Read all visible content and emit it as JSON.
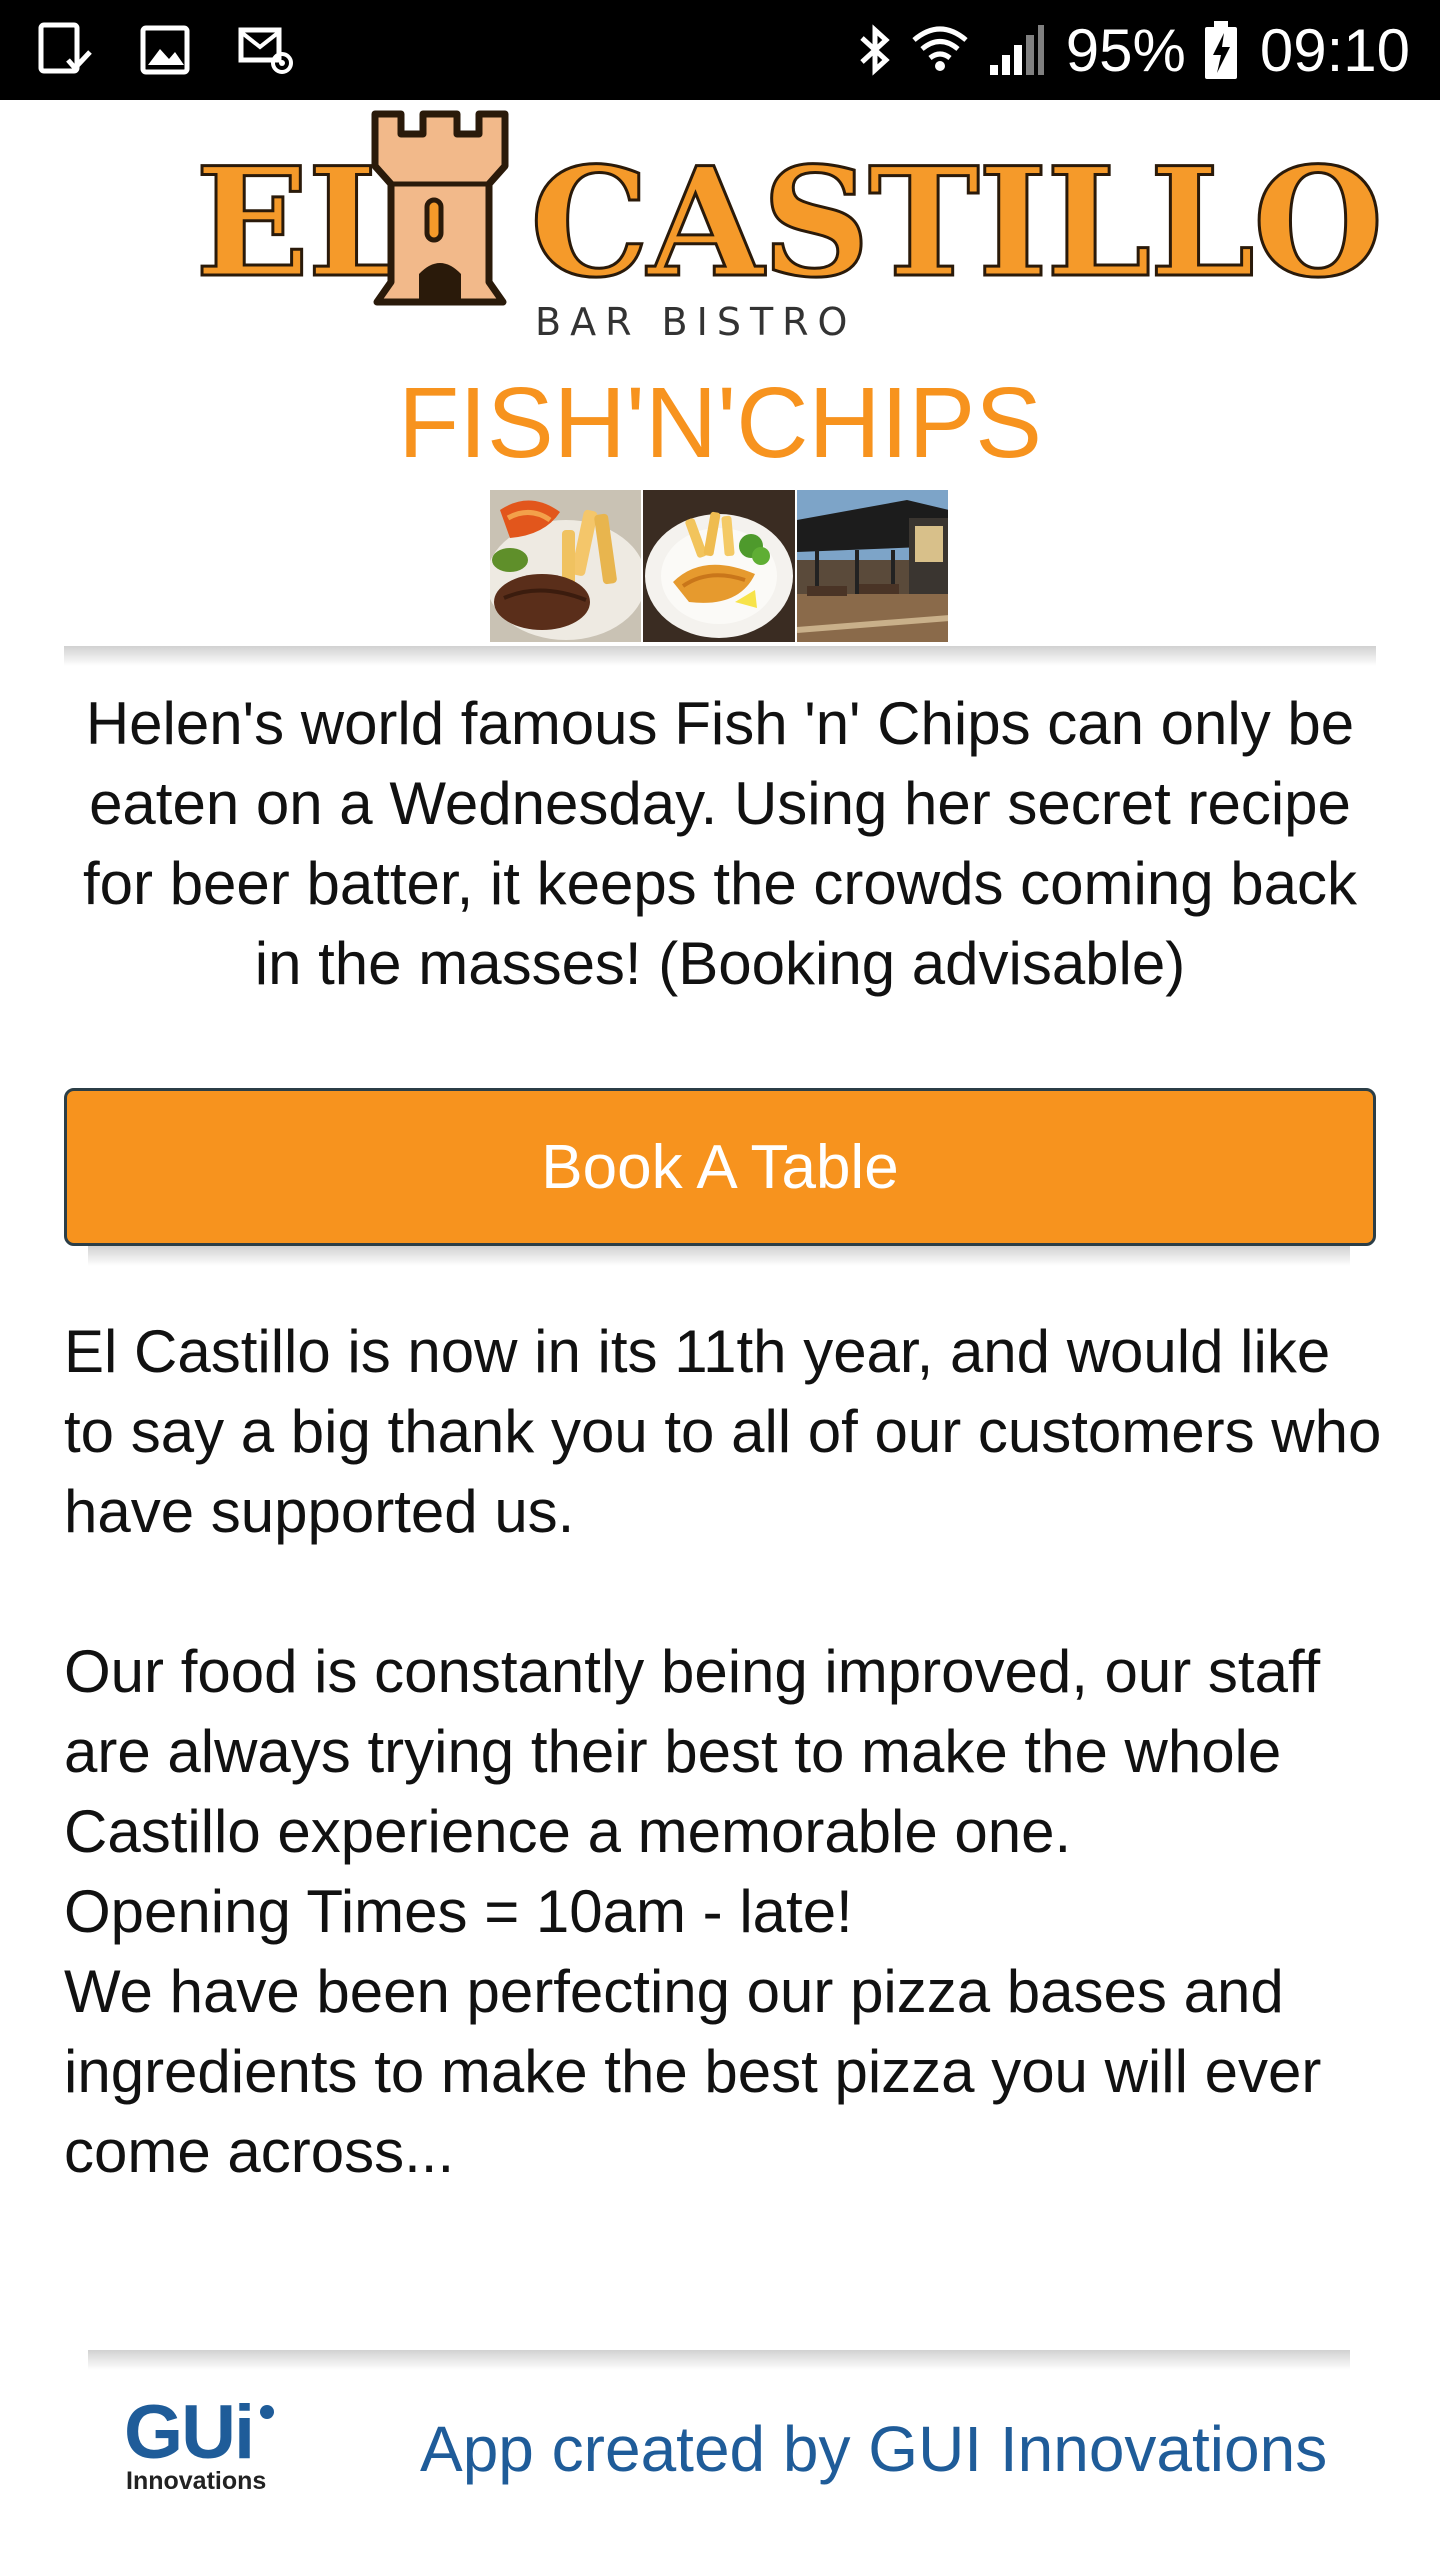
{
  "status_bar": {
    "left_icons": [
      "screenshot-check-icon",
      "image-icon",
      "email-alert-icon"
    ],
    "right_icons": [
      "bluetooth-icon",
      "wifi-icon",
      "cell-signal-icon",
      "battery-charging-icon"
    ],
    "battery": "95%",
    "time": "09:10"
  },
  "header": {
    "logo_word_1": "EL",
    "logo_word_2": "CASTILLO",
    "logo_tagline": "BAR BISTRO",
    "title": "FISH'N'CHIPS"
  },
  "gallery": {
    "photos": [
      "steak-and-chips-photo",
      "fish-and-chips-photo",
      "restaurant-terrace-photo"
    ]
  },
  "intro": {
    "text": "Helen's world famous Fish 'n' Chips can only be eaten on a Wednesday. Using her secret recipe for beer batter, it keeps the crowds coming back in the masses! (Booking advisable)"
  },
  "booking": {
    "button_label": "Book A Table"
  },
  "body": {
    "paragraph_1": "El Castillo is now in its 11th year, and would like to say a big thank you to all of our customers who have supported us.",
    "paragraph_2": "Our food is constantly being improved, our staff are always trying their best to make the whole Castillo experience a memorable one.",
    "opening_times": "Opening Times = 10am - late!",
    "paragraph_3": "We have been perfecting our pizza bases and ingredients to make the best pizza you will ever come across..."
  },
  "footer": {
    "brand_main": "GUi",
    "brand_sub": "Innovations",
    "credit": "App created by GUI Innovations"
  },
  "colors": {
    "accent_orange": "#f7931e",
    "button_border": "#2b3e47",
    "footer_blue": "#1f5c99"
  }
}
